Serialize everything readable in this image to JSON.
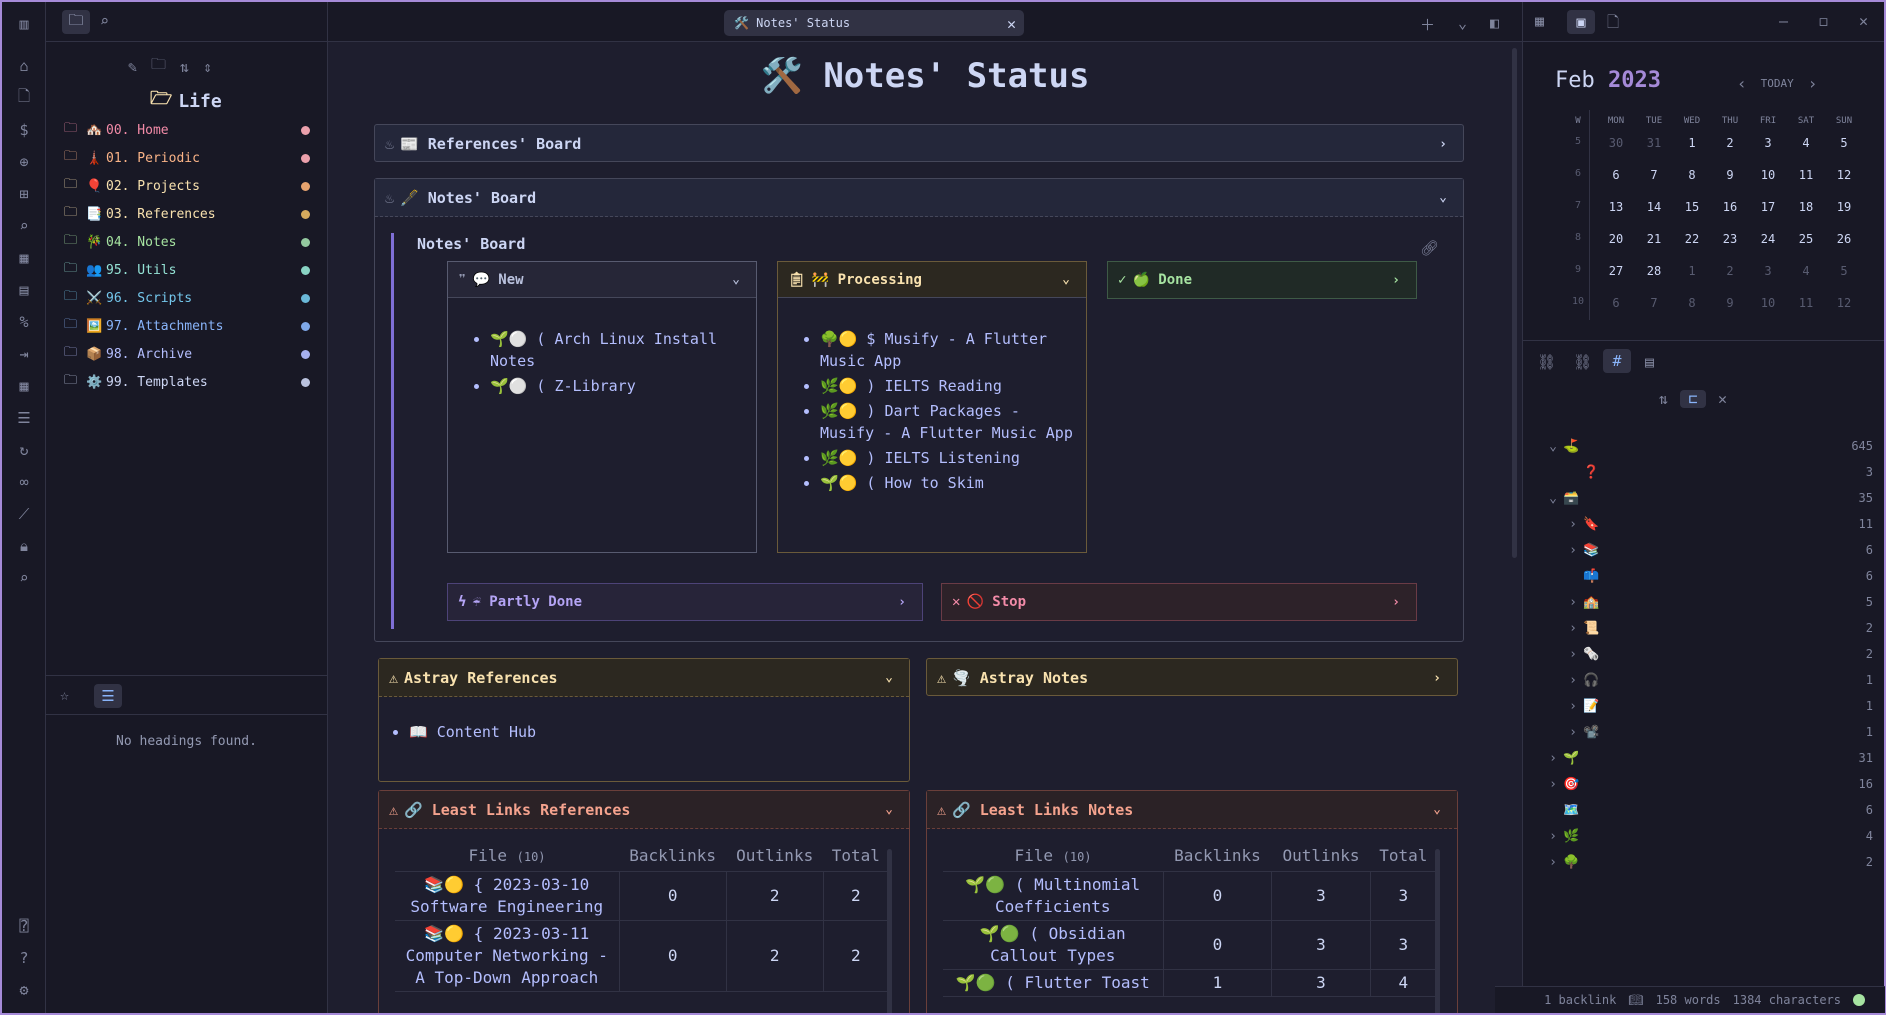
{
  "colors": {
    "accent": "#a58ad8",
    "bg": "#1e1e2e",
    "surface": "#181825",
    "text": "#cdd6f4",
    "link": "#b4befe"
  },
  "tab": {
    "title": "🛠️ Notes' Status"
  },
  "left": {
    "vault_name": "Life",
    "folders": [
      {
        "label": "00. Home",
        "emoji": "🏘️",
        "color": "#f38ba8",
        "dot": "#eba0ac"
      },
      {
        "label": "01. Periodic",
        "emoji": "🗼",
        "color": "#fab387",
        "dot": "#eba0ac"
      },
      {
        "label": "02. Projects",
        "emoji": "🎈",
        "color": "#f9e2af",
        "dot": "#e6a36f"
      },
      {
        "label": "03. References",
        "emoji": "📑",
        "color": "#f9e2af",
        "dot": "#d4a95d"
      },
      {
        "label": "04. Notes",
        "emoji": "🎋",
        "color": "#a6e3a1",
        "dot": "#94c9a0"
      },
      {
        "label": "95. Utils",
        "emoji": "👥",
        "color": "#94e2d5",
        "dot": "#89d3c4"
      },
      {
        "label": "96. Scripts",
        "emoji": "⚔️",
        "color": "#74c7ec",
        "dot": "#6ab8d8"
      },
      {
        "label": "97. Attachments",
        "emoji": "🖼️",
        "color": "#89b4fa",
        "dot": "#7fa8e8"
      },
      {
        "label": "98. Archive",
        "emoji": "📦",
        "color": "#b4befe",
        "dot": "#a6b0ee"
      },
      {
        "label": "99. Templates",
        "emoji": "⚙️",
        "color": "#cdd6f4",
        "dot": "#bac2de"
      }
    ],
    "outline_empty": "No headings found."
  },
  "main": {
    "page_title": "🛠️ Notes' Status",
    "refs_board": "📰 References' Board",
    "notes_board": "🖋️ Notes' Board",
    "notes_board_heading": "Notes' Board",
    "col_new": {
      "title": "💬 New",
      "items": [
        "🌱⚪ ( Arch Linux Install Notes",
        "🌱⚪ ( Z-Library"
      ]
    },
    "col_processing": {
      "title": "🚧 Processing",
      "items": [
        "🌳🟡 $ Musify - A Flutter Music App",
        "🌿🟡 ) IELTS Reading",
        "🌿🟡 ) Dart Packages - Musify - A Flutter Music App",
        "🌿🟡 ) IELTS Listening",
        "🌱🟡 ( How to Skim"
      ]
    },
    "col_done": {
      "title": "🍏 Done"
    },
    "partly_done": "☔ Partly Done",
    "stop": "🚫 Stop",
    "astray_refs": "Astray References",
    "astray_refs_item": "📖 Content Hub",
    "astray_notes": "🌪️ Astray Notes",
    "least_refs": "🔗 Least Links References",
    "least_notes": "🔗 Least Links Notes",
    "table_headers": {
      "file": "File",
      "count": "(10)",
      "back": "Backlinks",
      "out": "Outlinks",
      "total": "Total"
    },
    "refs_rows": [
      {
        "file": "📚🟡 { 2023-03-10 Software Engineering",
        "b": "0",
        "o": "2",
        "t": "2"
      },
      {
        "file": "📚🟡 { 2023-03-11 Computer Networking - A Top-Down Approach",
        "b": "0",
        "o": "2",
        "t": "2"
      }
    ],
    "notes_rows": [
      {
        "file": "🌱🟢 ( Multinomial Coefficients",
        "b": "0",
        "o": "3",
        "t": "3"
      },
      {
        "file": "🌱🟢 ( Obsidian Callout Types",
        "b": "0",
        "o": "3",
        "t": "3"
      },
      {
        "file": "🌱🟢 ( Flutter Toast",
        "b": "1",
        "o": "3",
        "t": "4"
      }
    ]
  },
  "calendar": {
    "month": "Feb",
    "year": "2023",
    "today": "TODAY",
    "days": [
      "W",
      "MON",
      "TUE",
      "WED",
      "THU",
      "FRI",
      "SAT",
      "SUN"
    ],
    "weeks": [
      [
        "5",
        "30",
        "31",
        "1",
        "2",
        "3",
        "4",
        "5"
      ],
      [
        "6",
        "6",
        "7",
        "8",
        "9",
        "10",
        "11",
        "12"
      ],
      [
        "7",
        "13",
        "14",
        "15",
        "16",
        "17",
        "18",
        "19"
      ],
      [
        "8",
        "20",
        "21",
        "22",
        "23",
        "24",
        "25",
        "26"
      ],
      [
        "9",
        "27",
        "28",
        "1",
        "2",
        "3",
        "4",
        "5"
      ],
      [
        "10",
        "6",
        "7",
        "8",
        "9",
        "10",
        "11",
        "12"
      ]
    ]
  },
  "tags": [
    {
      "label": "⛳",
      "count": "645",
      "indent": 0,
      "chev": "v"
    },
    {
      "label": "❓",
      "count": "3",
      "indent": 1,
      "chev": ""
    },
    {
      "label": "🗃️",
      "count": "35",
      "indent": 0,
      "chev": "v"
    },
    {
      "label": "🔖",
      "count": "11",
      "indent": 1,
      "chev": ">"
    },
    {
      "label": "📚",
      "count": "6",
      "indent": 1,
      "chev": ">"
    },
    {
      "label": "📫",
      "count": "6",
      "indent": 1,
      "chev": ""
    },
    {
      "label": "🏫",
      "count": "5",
      "indent": 1,
      "chev": ">"
    },
    {
      "label": "📜",
      "count": "2",
      "indent": 1,
      "chev": ">"
    },
    {
      "label": "🗞️",
      "count": "2",
      "indent": 1,
      "chev": ">"
    },
    {
      "label": "🎧",
      "count": "1",
      "indent": 1,
      "chev": ">"
    },
    {
      "label": "📝",
      "count": "1",
      "indent": 1,
      "chev": ">"
    },
    {
      "label": "📽️",
      "count": "1",
      "indent": 1,
      "chev": ">"
    },
    {
      "label": "🌱",
      "count": "31",
      "indent": 0,
      "chev": ">"
    },
    {
      "label": "🎯",
      "count": "16",
      "indent": 0,
      "chev": ">"
    },
    {
      "label": "🗺️",
      "count": "6",
      "indent": 0,
      "chev": ""
    },
    {
      "label": "🌿",
      "count": "4",
      "indent": 0,
      "chev": ">"
    },
    {
      "label": "🌳",
      "count": "2",
      "indent": 0,
      "chev": ">"
    }
  ],
  "status": {
    "backlinks": "1 backlink",
    "words": "158 words",
    "chars": "1384 characters"
  }
}
